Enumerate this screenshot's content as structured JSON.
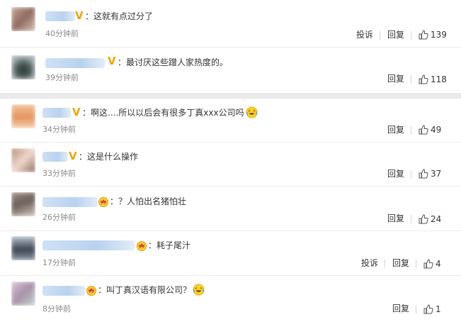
{
  "labels": {
    "report": "投诉",
    "reply": "回复"
  },
  "colors": {
    "vip_badge": "#f0a500",
    "name_blur": "#b9d2ee",
    "time": "#8a8a8a"
  },
  "comments": [
    {
      "text": "：这就有点过分了",
      "time": "40分钟前",
      "likes": "139",
      "badge": "v-badge",
      "has_report": true
    },
    {
      "text": "：最讨厌这些蹭人家热度的。",
      "time": "39分钟前",
      "likes": "118",
      "badge": "v-badge",
      "has_report": false
    },
    {
      "text": "：啊这....所以以后会有很多丁真xxx公司吗",
      "time": "34分钟前",
      "likes": "49",
      "badge": "v-badge",
      "has_report": false,
      "emoji": "laughing-crying-emoji"
    },
    {
      "text": "：这是什么操作",
      "time": "33分钟前",
      "likes": "37",
      "badge": "v-badge",
      "has_report": false
    },
    {
      "text": "：？人怕出名猪怕壮",
      "time": "26分钟前",
      "likes": "24",
      "badge": "crown-badge",
      "has_report": false
    },
    {
      "text": "：耗子尾汁",
      "time": "17分钟前",
      "likes": "4",
      "badge": "crown-badge",
      "has_report": true
    },
    {
      "text": "：叫丁真汉语有限公司？",
      "time": "8分钟前",
      "likes": "1",
      "badge": "crown-badge",
      "has_report": false,
      "emoji": "laughing-crying-emoji"
    }
  ]
}
